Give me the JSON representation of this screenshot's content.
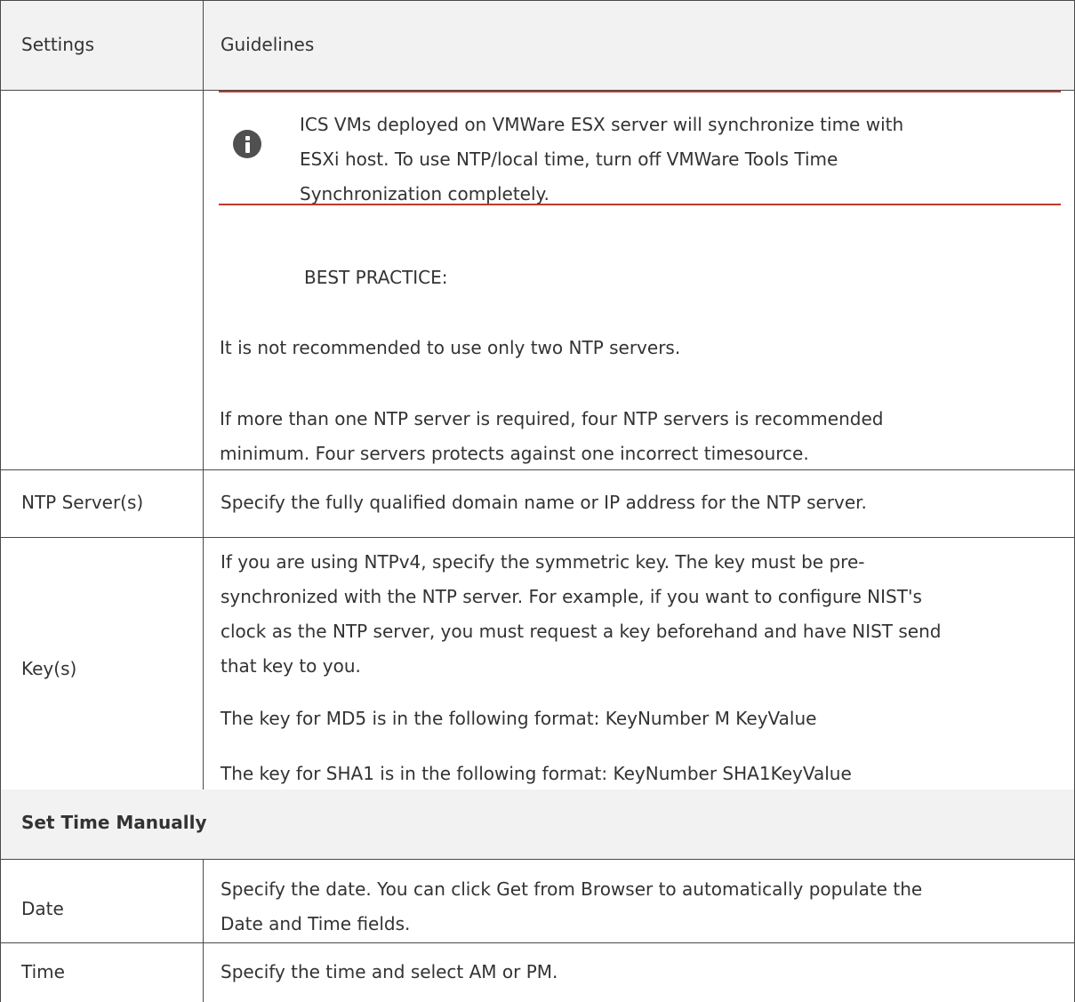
{
  "header": {
    "col1": "Settings",
    "col2": "Guidelines"
  },
  "note": {
    "icon": "info-icon",
    "lines": [
      "ICS VMs deployed on VMWare ESX server will synchronize time with",
      "ESXi host. To use NTP/local time, turn off VMWare Tools Time",
      "Synchronization completely."
    ]
  },
  "best_practice": {
    "heading": "BEST PRACTICE:",
    "para1": "It is not recommended to use only two NTP servers.",
    "para2_lines": [
      "If more than one NTP server is required, four NTP servers is recommended",
      "minimum. Four servers protects against one incorrect timesource."
    ]
  },
  "rows": {
    "ntp": {
      "setting": "NTP Server(s)",
      "guideline": "Specify the fully qualified domain name or IP address for the NTP server."
    },
    "keys": {
      "setting": "Key(s)",
      "guideline_lines": [
        "If you are using NTPv4, specify the symmetric key. The key must be pre-",
        "synchronized with the NTP server. For example, if you want to configure NIST's",
        "clock as the NTP server, you must request a key beforehand and have NIST send",
        "that key to you."
      ],
      "md5": "The key for MD5 is in the following format: KeyNumber M KeyValue",
      "sha1": "The key for SHA1 is in the following format: KeyNumber SHA1KeyValue"
    },
    "section": {
      "title": "Set Time Manually"
    },
    "date": {
      "setting": "Date",
      "guideline_lines": [
        "Specify the date. You can click Get from Browser to automatically populate the",
        "Date and Time fields."
      ]
    },
    "time": {
      "setting": "Time",
      "guideline": "Specify the time and select AM or PM."
    }
  }
}
